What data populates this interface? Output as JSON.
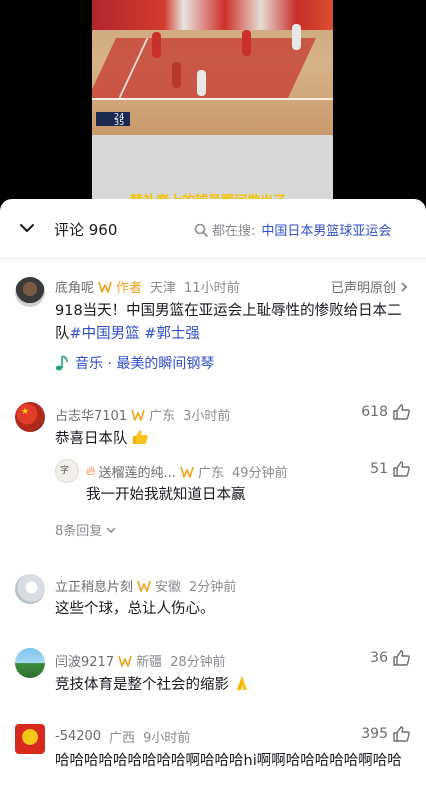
{
  "video": {
    "subtitle": "替补席上的球员瞬间做出了",
    "scoreboard": {
      "away": "24",
      "home": "35"
    }
  },
  "header": {
    "title": "评论 960",
    "search_prefix": "都在搜:",
    "search_topic": "中国日本男篮球亚运会"
  },
  "author_comment": {
    "name": "底角呢",
    "author_label": "作者",
    "location": "天津",
    "time": "11小时前",
    "right_note": "已声明原创",
    "text_plain": "918当天！中国男篮在亚运会上耻辱性的惨败给日本二队",
    "tag1": "#中国男篮",
    "tag2": "#郭士强",
    "music": "音乐 · 最美的瞬间钢琴"
  },
  "comments": [
    {
      "name": "占志华7101",
      "location": "广东",
      "time": "3小时前",
      "likes": "618",
      "text": "恭喜日本队",
      "reply": {
        "name": "送榴莲的纯...",
        "location": "广东",
        "time": "49分钟前",
        "likes": "51",
        "text": "我一开始我就知道日本赢"
      },
      "more_replies": "8条回复"
    },
    {
      "name": "立正稍息片刻",
      "location": "安徽",
      "time": "2分钟前",
      "likes": "",
      "text": "这些个球，总让人伤心。"
    },
    {
      "name": "闫波9217",
      "location": "新疆",
      "time": "28分钟前",
      "likes": "36",
      "text": "竞技体育是整个社会的缩影"
    },
    {
      "name": "-54200",
      "location": "广西",
      "time": "9小时前",
      "likes": "395",
      "text": "哈哈哈哈哈哈哈哈哈啊哈哈哈hi啊啊哈哈哈哈哈啊哈哈"
    }
  ]
}
